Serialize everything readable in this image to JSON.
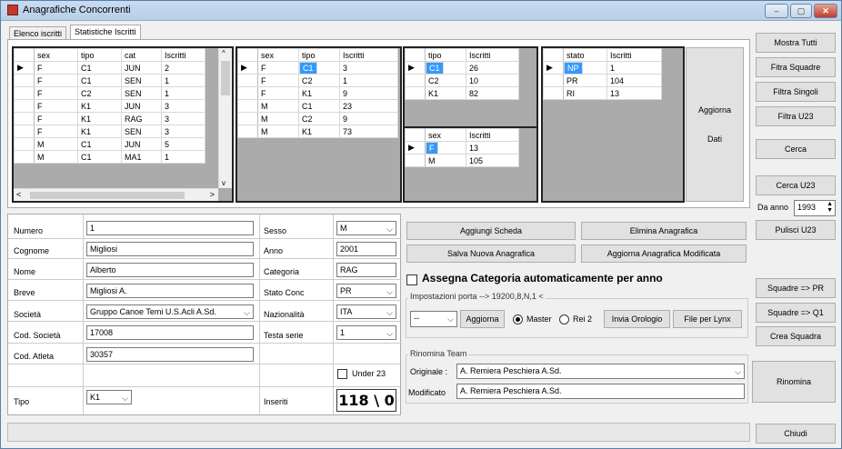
{
  "window": {
    "title": "Anagrafiche Concorrenti",
    "min": "–",
    "max": "▢",
    "close": "✕"
  },
  "tabs": [
    "Elenco iscritti",
    "Statistiche Iscritti"
  ],
  "grid1": {
    "headers": [
      "sex",
      "tipo",
      "cat",
      "Iscritti"
    ],
    "rows": [
      [
        "F",
        "C1",
        "JUN",
        "2"
      ],
      [
        "F",
        "C1",
        "SEN",
        "1"
      ],
      [
        "F",
        "C2",
        "SEN",
        "1"
      ],
      [
        "F",
        "K1",
        "JUN",
        "3"
      ],
      [
        "F",
        "K1",
        "RAG",
        "3"
      ],
      [
        "F",
        "K1",
        "SEN",
        "3"
      ],
      [
        "M",
        "C1",
        "JUN",
        "5"
      ],
      [
        "M",
        "C1",
        "MA1",
        "1"
      ]
    ]
  },
  "grid2": {
    "headers": [
      "sex",
      "tipo",
      "Iscritti"
    ],
    "rows": [
      [
        "F",
        "C1",
        "3"
      ],
      [
        "F",
        "C2",
        "1"
      ],
      [
        "F",
        "K1",
        "9"
      ],
      [
        "M",
        "C1",
        "23"
      ],
      [
        "M",
        "C2",
        "9"
      ],
      [
        "M",
        "K1",
        "73"
      ]
    ]
  },
  "grid3": {
    "headers": [
      "tipo",
      "Iscritti"
    ],
    "rows": [
      [
        "C1",
        "26"
      ],
      [
        "C2",
        "10"
      ],
      [
        "K1",
        "82"
      ]
    ]
  },
  "grid4": {
    "headers": [
      "sex",
      "Iscritti"
    ],
    "rows": [
      [
        "F",
        "13"
      ],
      [
        "M",
        "105"
      ]
    ]
  },
  "grid5": {
    "headers": [
      "stato",
      "Iscritti"
    ],
    "rows": [
      [
        "NP",
        "1"
      ],
      [
        "PR",
        "104"
      ],
      [
        "RI",
        "13"
      ]
    ]
  },
  "aggiorna_dati": {
    "line1": "Aggiorna",
    "line2": "Dati"
  },
  "right_buttons": {
    "mostra_tutti": "Mostra Tutti",
    "filtra_squadre": "Fitra Squadre",
    "filtra_singoli": "Filtra Singoli",
    "filtra_u23": "Filtra U23",
    "cerca": "Cerca",
    "cerca_u23": "Cerca U23",
    "da_anno_label": "Da anno",
    "da_anno_value": "1993",
    "pulisci_u23": "Pulisci U23",
    "squadre_pr": "Squadre => PR",
    "squadre_q1": "Squadre => Q1",
    "crea_squadra": "Crea Squadra",
    "chiudi": "Chiudi"
  },
  "form": {
    "numero_label": "Numero",
    "numero": "1",
    "cognome_label": "Cognome",
    "cognome": "Migliosi",
    "nome_label": "Nome",
    "nome": "Alberto",
    "breve_label": "Breve",
    "breve": "Migliosi A.",
    "societa_label": "Società",
    "societa": "Gruppo Canoe Temi U.S.Acli  A.Sd.",
    "cod_societa_label": "Cod. Società",
    "cod_societa": "17008",
    "cod_atleta_label": "Cod. Atleta",
    "cod_atleta": "30357",
    "tipo_label": "Tipo",
    "tipo": "K1",
    "sesso_label": "Sesso",
    "sesso": "M",
    "anno_label": "Anno",
    "anno": "2001",
    "categoria_label": "Categoria",
    "categoria": "RAG",
    "stato_conc_label": "Stato Conc",
    "stato_conc": "PR",
    "nazionalita_label": "Nazionalità",
    "nazionalita": "ITA",
    "testa_serie_label": "Testa serie",
    "testa_serie": "1",
    "under23_label": "Under 23",
    "inseriti_label": "Inseriti",
    "inseriti": "118 \\ 0"
  },
  "actions": {
    "aggiungi_scheda": "Aggiungi Scheda",
    "elimina_anagrafica": "Elimina Anagrafica",
    "salva_nuova": "Salva Nuova Anagrafica",
    "aggiorna_modificata": "Aggiorna Anagrafica Modificata",
    "assegna_categoria": "Assegna Categoria automaticamente per anno"
  },
  "porta": {
    "title": "Impostazioni porta --> 19200,8,N,1 <",
    "select": "--",
    "aggiorna": "Aggiorna",
    "master": "Master",
    "rei2": "Rei 2",
    "invia_orologio": "Invia Orologio",
    "file_lynx": "File  per Lynx"
  },
  "rinomina": {
    "title": "Rinomina Team",
    "originale_label": "Originale :",
    "originale": "A. Remiera Peschiera A.Sd.",
    "modificato_label": "Modificato",
    "modificato": "A. Remiera Peschiera A.Sd.",
    "button": "Rinomina"
  }
}
